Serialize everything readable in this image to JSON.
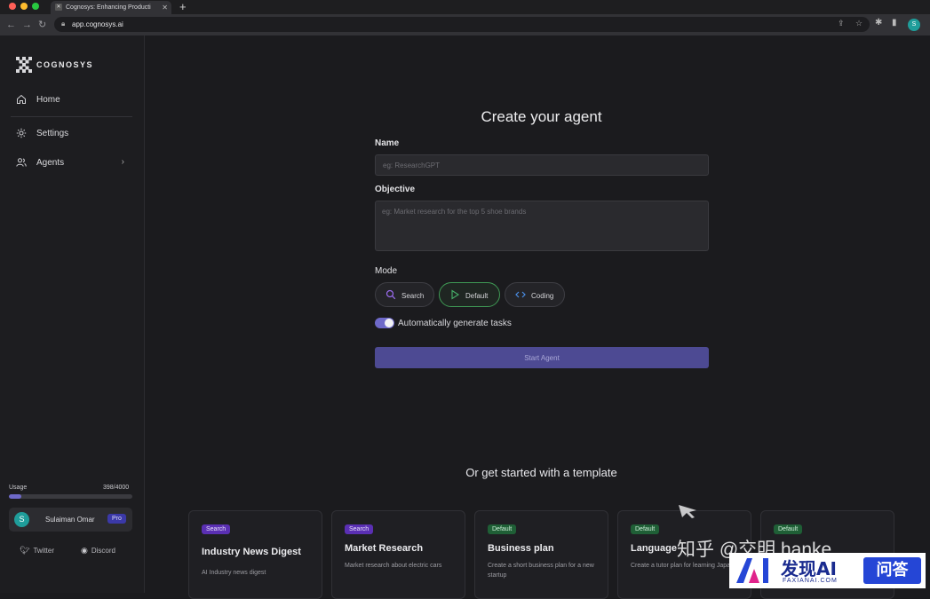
{
  "browser": {
    "tab_title": "Cognosys: Enhancing Producti",
    "url": "app.cognosys.ai",
    "profile_initial": "S"
  },
  "sidebar": {
    "brand": "COGNOSYS",
    "items": [
      {
        "label": "Home",
        "icon": "home-icon"
      },
      {
        "label": "Settings",
        "icon": "gear-icon"
      },
      {
        "label": "Agents",
        "icon": "users-icon"
      }
    ],
    "usage": {
      "label": "Usage",
      "count": "398/4000",
      "used": 398,
      "limit": 4000
    },
    "user": {
      "initial": "S",
      "name": "Sulaiman Omar",
      "plan": "Pro"
    },
    "social": {
      "twitter": "Twitter",
      "discord": "Discord"
    }
  },
  "form": {
    "title": "Create your agent",
    "name_label": "Name",
    "name_placeholder": "eg: ResearchGPT",
    "objective_label": "Objective",
    "objective_placeholder": "eg: Market research for the top 5 shoe brands",
    "mode_label": "Mode",
    "modes": [
      "Search",
      "Default",
      "Coding"
    ],
    "selected_mode": "Default",
    "auto_tasks_label": "Automatically generate tasks",
    "auto_tasks_on": true,
    "start_label": "Start Agent"
  },
  "templates": {
    "heading": "Or get started with a template",
    "cards": [
      {
        "badge": "Search",
        "title": "Industry News Digest",
        "desc": "AI Industry news digest"
      },
      {
        "badge": "Search",
        "title": "Market Research",
        "desc": "Market research about electric cars"
      },
      {
        "badge": "Default",
        "title": "Business plan",
        "desc": "Create a short business plan for a new startup"
      },
      {
        "badge": "Default",
        "title": "Language",
        "desc": "Create a tutor plan for learning Japanese"
      },
      {
        "badge": "Default",
        "title": "",
        "desc": ""
      }
    ]
  },
  "watermark": {
    "zh_text": "知乎 @交明 hanke",
    "brand": "发现AI",
    "url": "FAXIANAI.COM",
    "qa": "问答"
  },
  "colors": {
    "accent": "#6e69c9",
    "start_button": "#4d4a93",
    "search_badge": "#5a2fb3",
    "default_badge": "#1f5f36",
    "default_mode_border": "#3f9a55"
  }
}
